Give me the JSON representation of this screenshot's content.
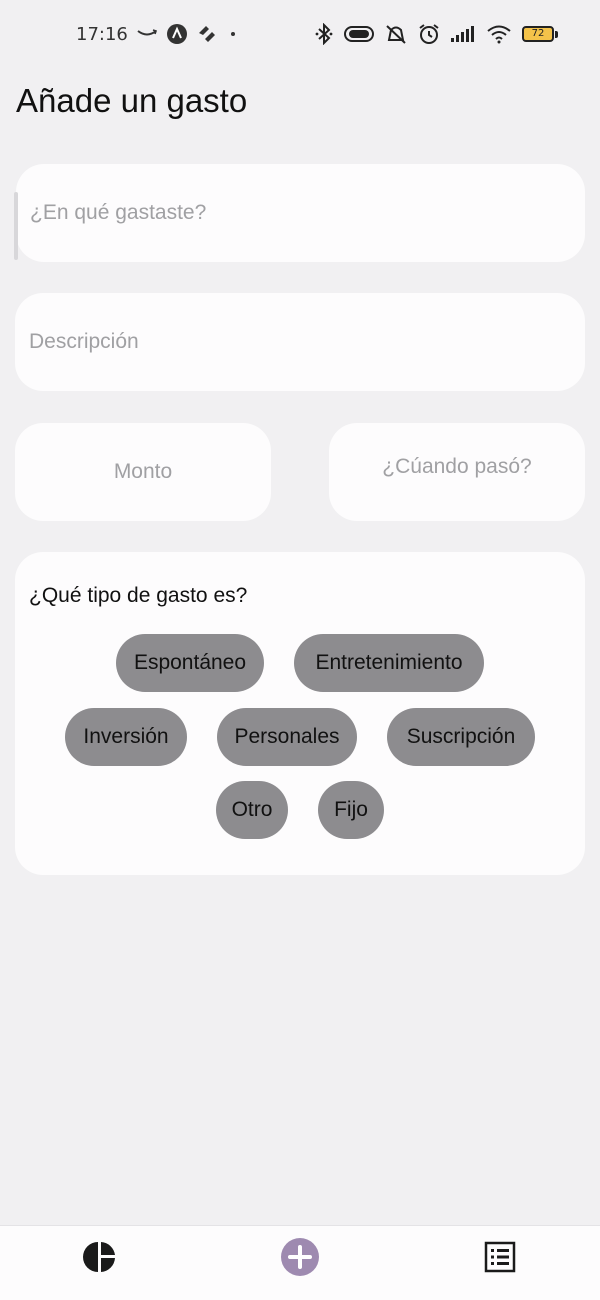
{
  "status_bar": {
    "time": "17:16",
    "battery_level": "72",
    "left_icons": [
      "amazon-smile-icon",
      "app-a-icon",
      "heart-hands-icon",
      "dot-icon"
    ],
    "right_icons": [
      "bluetooth-icon",
      "pill-toggle-icon",
      "vibrate-off-icon",
      "alarm-icon",
      "signal-icon",
      "wifi-icon",
      "battery-icon"
    ]
  },
  "header": {
    "title": "Añade un gasto"
  },
  "form": {
    "what_placeholder": "¿En qué gastaste?",
    "description_placeholder": "Descripción",
    "amount_placeholder": "Monto",
    "when_placeholder": "¿Cúando pasó?"
  },
  "expense_type": {
    "title": "¿Qué tipo de gasto es?",
    "options": [
      "Espontáneo",
      "Entretenimiento",
      "Inversión",
      "Personales",
      "Suscripción",
      "Otro",
      "Fijo"
    ]
  },
  "bottom_nav": {
    "items": [
      "chart-pie-icon",
      "add-circle-icon",
      "list-icon"
    ],
    "active": "add-circle-icon"
  },
  "colors": {
    "background": "#f1f0f2",
    "card": "#fdfcfd",
    "chip": "#8d8c8f",
    "accent": "#9e8ab0",
    "battery": "#f4c34a"
  }
}
